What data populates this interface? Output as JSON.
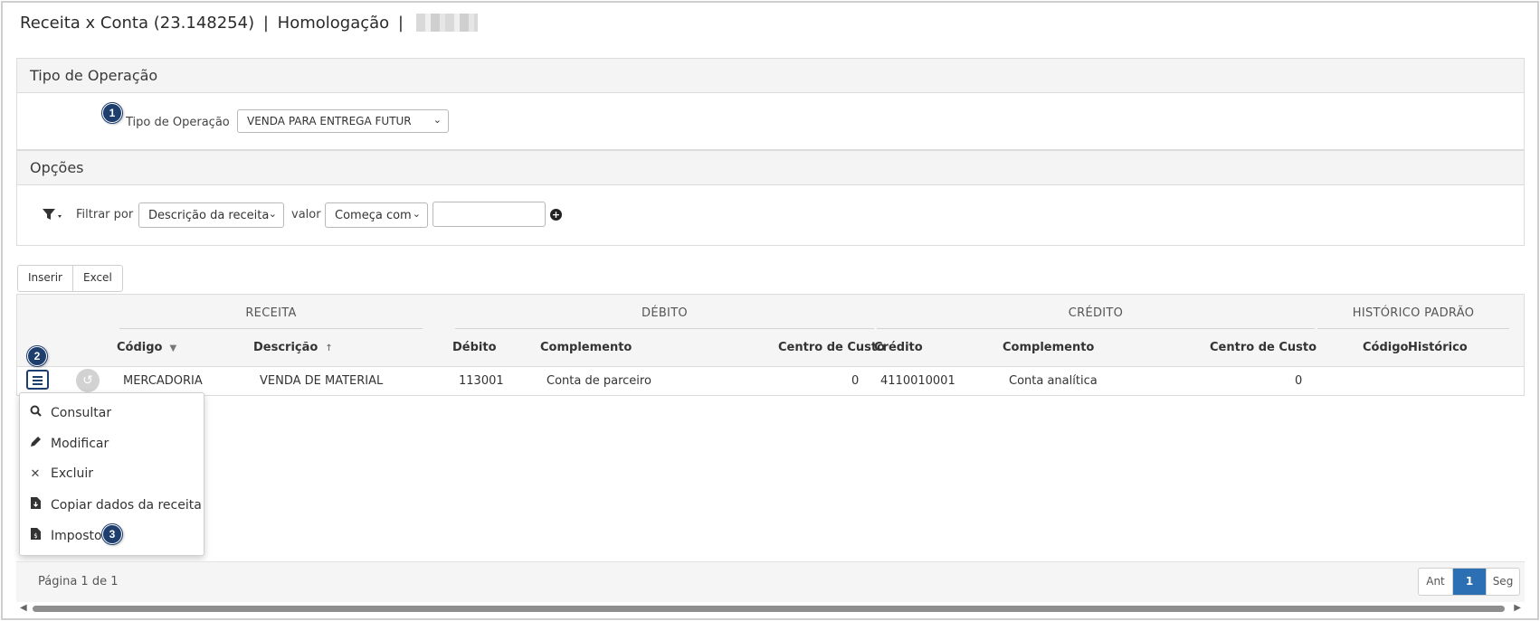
{
  "header": {
    "title": "Receita x Conta (23.148254)",
    "separator": "|",
    "environment": "Homologação"
  },
  "tipo_operacao_panel": {
    "title": "Tipo de Operação",
    "field_label": "Tipo de Operação",
    "selected_value": "VENDA PARA ENTREGA FUTUR",
    "badge": "1"
  },
  "opcoes_panel": {
    "title": "Opções",
    "filter_label": "Filtrar por",
    "filter_field": "Descrição da receita",
    "value_label": "valor",
    "operator": "Começa com",
    "search_value": ""
  },
  "toolbar": {
    "insert_label": "Inserir",
    "excel_label": "Excel"
  },
  "grid": {
    "groups": {
      "receita": "RECEITA",
      "debito": "DÉBITO",
      "credito": "CRÉDITO",
      "historico": "HISTÓRICO PADRÃO"
    },
    "columns": {
      "codigo": "Código",
      "descricao": "Descrição",
      "debito": "Débito",
      "complemento_debito": "Complemento",
      "centro_custo_debito": "Centro de Custo",
      "credito": "Crédito",
      "complemento_credito": "Complemento",
      "centro_custo_credito": "Centro de Custo",
      "codigo_historico": "Código",
      "historico": "Histórico"
    },
    "rows": [
      {
        "codigo": "MERCADORIA",
        "descricao": "VENDA DE MATERIAL",
        "debito": "113001",
        "complemento_debito": "Conta de parceiro",
        "centro_custo_debito": "0",
        "credito": "4110010001",
        "complemento_credito": "Conta analítica",
        "centro_custo_credito": "0"
      }
    ],
    "row_badge": "2"
  },
  "row_menu": {
    "items": [
      {
        "label": "Consultar",
        "icon": "search-icon"
      },
      {
        "label": "Modificar",
        "icon": "pencil-icon"
      },
      {
        "label": "Excluir",
        "icon": "close-icon"
      },
      {
        "label": "Copiar dados da receita",
        "icon": "file-copy-icon"
      },
      {
        "label": "Impostos",
        "icon": "tax-file-icon"
      }
    ],
    "badge": "3"
  },
  "pagination": {
    "summary": "Página 1 de 1",
    "prev_label": "Ant",
    "current_page": "1",
    "next_label": "Seg"
  },
  "colors": {
    "badge": "#1e3e6e",
    "active_page": "#2c6fb3"
  }
}
